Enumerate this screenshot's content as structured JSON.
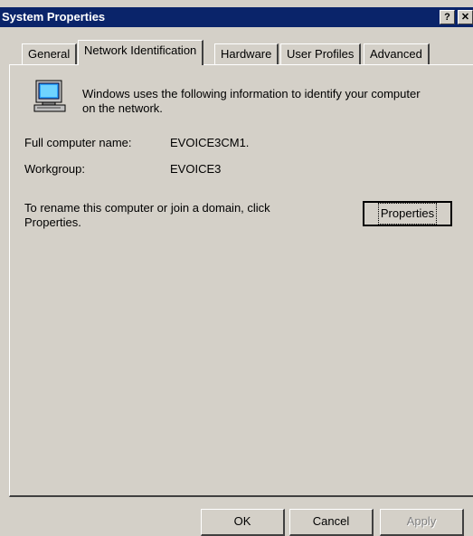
{
  "window": {
    "title": "System Properties",
    "help_glyph": "?",
    "close_glyph": "✕"
  },
  "tabs": [
    {
      "label": "General"
    },
    {
      "label": "Network Identification"
    },
    {
      "label": "Hardware"
    },
    {
      "label": "User Profiles"
    },
    {
      "label": "Advanced"
    }
  ],
  "panel": {
    "description": "Windows uses the following information to identify your computer on the network.",
    "description_line1": "Windows uses the following information to identify your computer",
    "description_line2": "on the network.",
    "full_name_label": "Full computer name:",
    "full_name_value": "EVOICE3CM1.",
    "workgroup_label": "Workgroup:",
    "workgroup_value": "EVOICE3",
    "rename_line1": "To rename this computer or join a domain, click",
    "rename_line2": "Properties.",
    "properties_button": "Properties"
  },
  "footer": {
    "ok": "OK",
    "cancel": "Cancel",
    "apply": "Apply"
  }
}
